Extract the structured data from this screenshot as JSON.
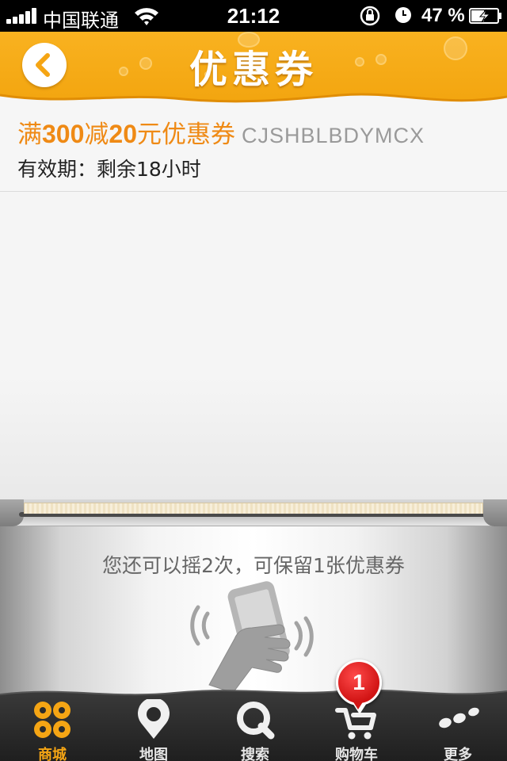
{
  "status_bar": {
    "carrier": "中国联通",
    "time": "21:12",
    "battery_percent": "47 %",
    "icons": [
      "signal-icon",
      "wifi-icon",
      "rotation-lock-icon",
      "alarm-icon",
      "battery-charging-icon"
    ]
  },
  "header": {
    "title": "优惠券",
    "back_icon": "chevron-left-icon"
  },
  "coupon": {
    "title_prefix": "满",
    "amount_threshold": "300",
    "title_mid": "减",
    "amount_discount": "20",
    "title_suffix": "元优惠券",
    "code": "CJSHBLBDYMCX",
    "validity": "有效期：剩余18小时"
  },
  "shaker": {
    "hint": "您还可以摇2次，可保留1张优惠券",
    "illustration": "shake-phone-icon"
  },
  "tab_bar": {
    "tabs": [
      {
        "label": "商城",
        "icon": "mall-icon",
        "active": true
      },
      {
        "label": "地图",
        "icon": "map-pin-icon",
        "active": false
      },
      {
        "label": "搜索",
        "icon": "search-icon",
        "active": false
      },
      {
        "label": "购物车",
        "icon": "cart-icon",
        "active": false
      },
      {
        "label": "更多",
        "icon": "more-icon",
        "active": false
      }
    ],
    "cart_badge": "1"
  },
  "colors": {
    "brand_orange": "#f5a514",
    "coupon_title": "#ef8a15",
    "badge_red": "#d11414",
    "tab_bar_bg": "#2b2b2b"
  }
}
